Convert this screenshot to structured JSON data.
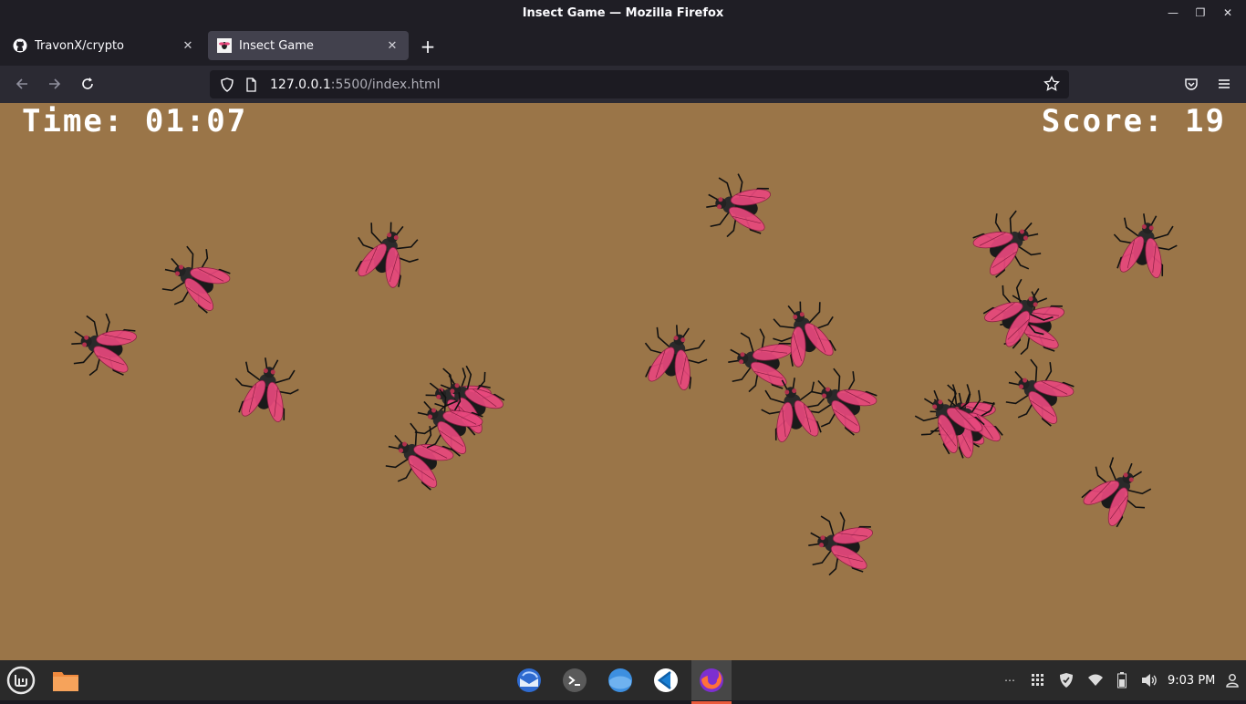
{
  "window": {
    "title": "Insect Game — Mozilla Firefox"
  },
  "tabs": [
    {
      "label": "TravonX/crypto",
      "active": false
    },
    {
      "label": "Insect Game",
      "active": true
    }
  ],
  "urlbar": {
    "host": "127.0.0.1",
    "rest": ":5500/index.html"
  },
  "game": {
    "time_label": "Time:",
    "time_value": "01:07",
    "score_label": "Score:",
    "score_value": "19",
    "background_color": "#9a7548",
    "insect_count": 24,
    "insect_wing_color": "#e8487d"
  },
  "taskbar": {
    "clock": "9:03 PM",
    "launchers": [
      "mint-menu-icon",
      "files-icon"
    ],
    "apps": [
      "thunderbird-icon",
      "terminal-icon",
      "browser-icon",
      "vscode-icon",
      "firefox-icon"
    ],
    "tray": [
      "overflow-icon",
      "apps-grid-icon",
      "shield-icon",
      "wifi-icon",
      "battery-icon",
      "volume-icon",
      "user-icon"
    ]
  }
}
